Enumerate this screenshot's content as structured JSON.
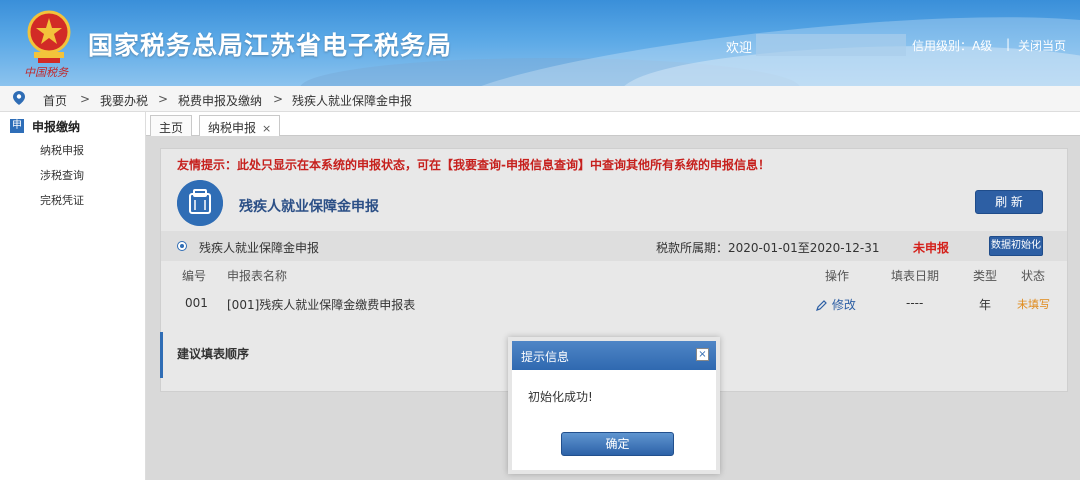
{
  "header": {
    "site_title": "国家税务总局江苏省电子税务局",
    "logo_script": "中国税务",
    "welcome": "欢迎",
    "credit_level": "信用级别：A级",
    "separator": "|",
    "close_page": "关闭当页"
  },
  "breadcrumb": {
    "items": [
      "首页",
      "我要办税",
      "税费申报及缴纳",
      "残疾人就业保障金申报"
    ],
    "separator": ">"
  },
  "sidebar": {
    "icon_text": "申",
    "heading": "申报缴纳",
    "items": [
      "纳税申报",
      "涉税查询",
      "完税凭证"
    ]
  },
  "tabs": [
    {
      "label": "主页"
    },
    {
      "label": "纳税申报",
      "close": "×"
    }
  ],
  "main": {
    "notice": "友情提示：此处只显示在本系统的申报状态，可在【我要查询-申报信息查询】中查询其他所有系统的申报信息！",
    "form_title": "残疾人就业保障金申报",
    "refresh_label": "刷 新",
    "row": {
      "name": "残疾人就业保障金申报",
      "period": "税款所属期：2020-01-01至2020-12-31",
      "status": "未申报",
      "init_label": "数据初始化"
    },
    "table": {
      "headers": [
        "编号",
        "申报表名称",
        "操作",
        "填表日期",
        "类型",
        "状态"
      ],
      "rows": [
        {
          "id": "001",
          "name": "[001]残疾人就业保障金缴费申报表",
          "action": "修改",
          "date": "----",
          "type": "年",
          "status": "未填写"
        }
      ]
    },
    "order_title": "建议填表顺序"
  },
  "modal": {
    "title": "提示信息",
    "close": "×",
    "message": "初始化成功!",
    "ok_label": "确定"
  },
  "colors": {
    "brand_blue": "#2f6db5",
    "alert_red": "#c6201d",
    "status_orange": "#e08a1a"
  }
}
